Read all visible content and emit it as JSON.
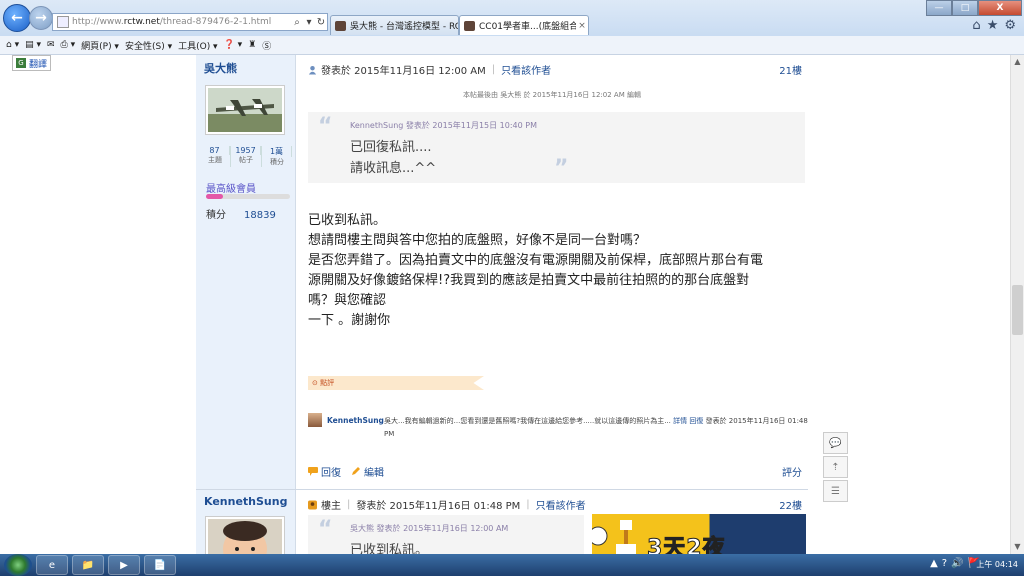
{
  "browser": {
    "url_prefix": "http://www.",
    "url_host": "rctw.net",
    "url_path": "/thread-879476-2-1.html",
    "tabs": [
      {
        "label": "吳大熊 - 台灣遙控模型 - RC T...",
        "active": false
      },
      {
        "label": "CC01學者車...(底盤組合驗...",
        "active": true
      }
    ],
    "window_controls": {
      "minimize": "—",
      "maximize": "□",
      "close": "X"
    },
    "right_icons": [
      "⌂",
      "★",
      "⚙"
    ]
  },
  "command_bar": {
    "items": [
      "網頁(P) ▾",
      "安全性(S) ▾",
      "工具(O) ▾",
      "❓ ▾"
    ],
    "translate_label": "翻譯"
  },
  "posts": [
    {
      "author": "吳大熊",
      "stats": [
        {
          "value": "87",
          "label": "主題"
        },
        {
          "value": "1957",
          "label": "帖子"
        },
        {
          "value": "1萬",
          "label": "積分"
        }
      ],
      "rank": "最高級會員",
      "rank_progress": 0.2,
      "points_label": "積分",
      "points_value": "18839",
      "posted_at": "發表於 2015年11月16日 12:00 AM",
      "view_author": "只看該作者",
      "floor": "21樓",
      "edit_note": "本帖最後由 吳大熊 於 2015年11月16日 12:02 AM 編輯",
      "quote": {
        "by": "KennethSung 發表於 2015年11月15日 10:40 PM",
        "lines": [
          "已回復私訊....",
          "請收訊息...^^"
        ]
      },
      "body": [
        "已收到私訊。",
        "想請問樓主問與答中您拍的底盤照，好像不是同一台對嗎？",
        "是否您弄錯了。因為拍賣文中的底盤沒有電源開關及前保桿，底部照片那台有電",
        "源開關及好像鍍鉻保桿!?我買到的應該是拍賣文中最前往拍照的的那台底盤對",
        "嗎？與您確認",
        "一下 。謝謝你"
      ],
      "rate_label": "點評",
      "comment": {
        "name": "KennethSung",
        "text": "吳大...我有編輯過新的...您看到還是舊照嗎?我傳在這邊給您參考.....就以這邊傳的照片為主...",
        "link_detail": "詳情",
        "link_reply": "回復",
        "time": "發表於 2015年11月16日 01:48 PM"
      },
      "actions": {
        "reply": "回復",
        "edit": "編輯",
        "rate": "評分"
      }
    },
    {
      "author": "KennethSung",
      "badge": "樓主",
      "posted_at": "發表於 2015年11月16日 01:48 PM",
      "view_author": "只看該作者",
      "floor": "22樓",
      "quote": {
        "by": "吳大熊 發表於 2015年11月16日 12:00 AM",
        "lines": [
          "已收到私訊。"
        ]
      },
      "ad_text": "3天2夜"
    }
  ],
  "taskbar": {
    "apps": [
      "e",
      "📁",
      "▶",
      "📄"
    ],
    "tray": [
      "▲",
      "?",
      "🔊",
      "🚩"
    ],
    "clock": "上午 04:14"
  }
}
